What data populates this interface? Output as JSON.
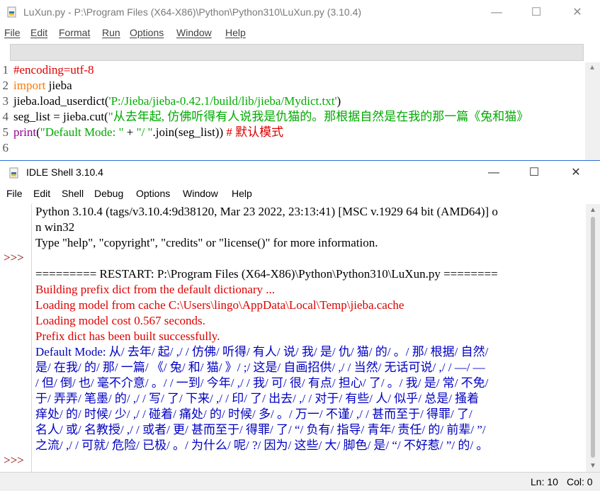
{
  "editor": {
    "title": "LuXun.py - P:\\Program Files (X64-X86)\\Python\\Python310\\LuXun.py (3.10.4)",
    "menu": [
      "File",
      "Edit",
      "Format",
      "Run",
      "Options",
      "Window",
      "Help"
    ],
    "line_numbers": [
      "1",
      "2",
      "3",
      "4",
      "5",
      "6"
    ],
    "code": {
      "l1": "#encoding=utf-8",
      "l2_kw": "import",
      "l2_rest": " jieba",
      "l3_pre": "jieba.load_userdict(",
      "l3_str": "'P:/Jieba/jieba-0.42.1/build/lib/jieba/Mydict.txt'",
      "l3_post": ")",
      "l4_pre": "seg_list = jieba.cut(",
      "l4_str": "\"从去年起, 仿佛听得有人说我是仇猫的。那根据自然是在我的那一篇《兔和猫》",
      "l5_bi": "print",
      "l5_a": "(",
      "l5_s1": "\"Default Mode: \"",
      "l5_b": " + ",
      "l5_s2": "\"/ \"",
      "l5_c": ".join(seg_list))  ",
      "l5_cmt": "# 默认模式"
    }
  },
  "shell": {
    "title": "IDLE Shell 3.10.4",
    "menu": [
      "File",
      "Edit",
      "Shell",
      "Debug",
      "Options",
      "Window",
      "Help"
    ],
    "prompts": [
      ">>>",
      ">>>"
    ],
    "lines": [
      "Python 3.10.4 (tags/v3.10.4:9d38120, Mar 23 2022, 23:13:41) [MSC v.1929 64 bit (AMD64)] o",
      "n win32",
      "Type \"help\", \"copyright\", \"credits\" or \"license()\" for more information.",
      "",
      "========= RESTART: P:\\Program Files (X64-X86)\\Python\\Python310\\LuXun.py ========",
      "Building prefix dict from the default dictionary ...",
      "Loading model from cache C:\\Users\\lingo\\AppData\\Local\\Temp\\jieba.cache",
      "Loading model cost 0.567 seconds.",
      "Prefix dict has been built successfully.",
      "Default Mode: 从/ 去年/ 起/ ,/ / 仿佛/ 听得/ 有人/ 说/ 我/ 是/ 仇/ 猫/ 的/ 。/ 那/ 根据/ 自然/",
      "是/ 在我/ 的/ 那/ 一篇/ 《/ 兔/ 和/ 猫/ 》/ ;/ 这是/ 自画招供/ ,/ / 当然/ 无话可说/ ,/ / —/ —",
      "/ 但/ 倒/ 也/ 毫不介意/ 。/ / 一到/ 今年/ ,/ / 我/ 可/ 很/ 有点/ 担心/ 了/ 。/ 我/ 是/ 常/ 不免/",
      "于/ 弄弄/ 笔墨/ 的/ ,/ / 写/ 了/ 下来/ ,/ / 印/ 了/ 出去/ ,/ / 对于/ 有些/ 人/ 似乎/ 总是/ 搔着",
      "痒处/ 的/ 时候/ 少/ ,/ / 碰着/ 痛处/ 的/ 时候/ 多/ 。/ 万一/ 不谨/ ,/ / 甚而至于/ 得罪/ 了/",
      "名人/ 或/ 名教授/ ,/ / 或者/ 更/ 甚而至于/ 得罪/ 了/ “/ 负有/ 指导/ 青年/ 责任/ 的/ 前辈/ ”/",
      "之流/ ,/ / 可就/ 危险/ 已极/ 。/ 为什么/ 呢/ ?/ 因为/ 这些/ 大/ 脚色/ 是/ “/ 不好惹/ ”/ 的/ 。"
    ],
    "status": {
      "ln": "Ln: 10",
      "col": "Col: 0"
    }
  },
  "colors": {
    "comment": "#dd0000",
    "keyword": "#ff7700",
    "string": "#00aa00",
    "builtin": "#900090",
    "stderr": "#dd0000",
    "stdout": "#0000c0",
    "prompt": "#8b0000"
  },
  "icons": [
    "python-file-icon",
    "minimize-icon",
    "maximize-icon",
    "close-icon"
  ]
}
